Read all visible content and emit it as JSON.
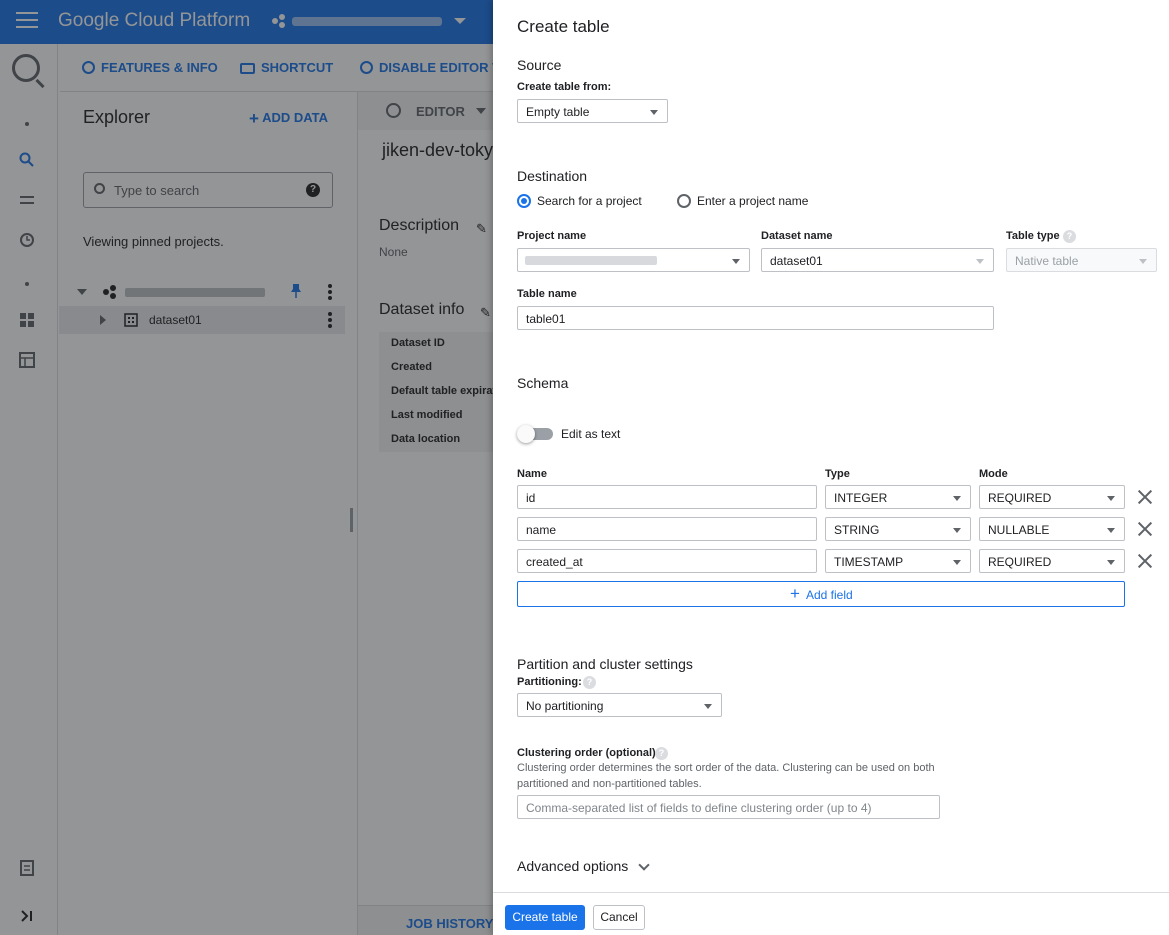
{
  "app": {
    "title": "Google Cloud Platform"
  },
  "toolbar": {
    "features_label": "FEATURES & INFO",
    "shortcut_label": "SHORTCUT",
    "disable_editor_label": "DISABLE EDITOR TA"
  },
  "explorer": {
    "title": "Explorer",
    "add_data_label": "ADD DATA",
    "search_placeholder": "Type to search",
    "pinned_text": "Viewing pinned projects.",
    "dataset_name": "dataset01"
  },
  "main": {
    "editor_tab": "EDITOR",
    "dataset_title": "jiken-dev-tokyo",
    "description_heading": "Description",
    "description_value": "None",
    "dataset_info_heading": "Dataset info",
    "dataset_info_rows": [
      "Dataset ID",
      "Created",
      "Default table expiratio",
      "Last modified",
      "Data location"
    ],
    "job_history_tab": "JOB HISTORY"
  },
  "drawer": {
    "title": "Create table",
    "source": {
      "heading": "Source",
      "create_from_label": "Create table from:",
      "create_from_value": "Empty table"
    },
    "destination": {
      "heading": "Destination",
      "radio_search_label": "Search for a project",
      "radio_enter_label": "Enter a project name",
      "selected_radio": "search",
      "project_label": "Project name",
      "dataset_label": "Dataset name",
      "dataset_value": "dataset01",
      "table_type_label": "Table type",
      "table_type_value": "Native table",
      "table_name_label": "Table name",
      "table_name_value": "table01"
    },
    "schema": {
      "heading": "Schema",
      "edit_as_text_label": "Edit as text",
      "edit_as_text_on": false,
      "col_name": "Name",
      "col_type": "Type",
      "col_mode": "Mode",
      "fields": [
        {
          "name": "id",
          "type": "INTEGER",
          "mode": "REQUIRED"
        },
        {
          "name": "name",
          "type": "STRING",
          "mode": "NULLABLE"
        },
        {
          "name": "created_at",
          "type": "TIMESTAMP",
          "mode": "REQUIRED"
        }
      ],
      "add_field_label": "Add field"
    },
    "partition": {
      "heading": "Partition and cluster settings",
      "partitioning_label": "Partitioning:",
      "partitioning_value": "No partitioning",
      "clustering_label": "Clustering order (optional):",
      "clustering_help": "Clustering order determines the sort order of the data. Clustering can be used on both partitioned and non-partitioned tables.",
      "clustering_placeholder": "Comma-separated list of fields to define clustering order (up to 4)"
    },
    "advanced_label": "Advanced options",
    "create_button": "Create table",
    "cancel_button": "Cancel"
  },
  "colors": {
    "primary": "#1a73e8",
    "topbar": "#1a73e8",
    "overlay": "rgba(32,33,36,0.48)"
  }
}
